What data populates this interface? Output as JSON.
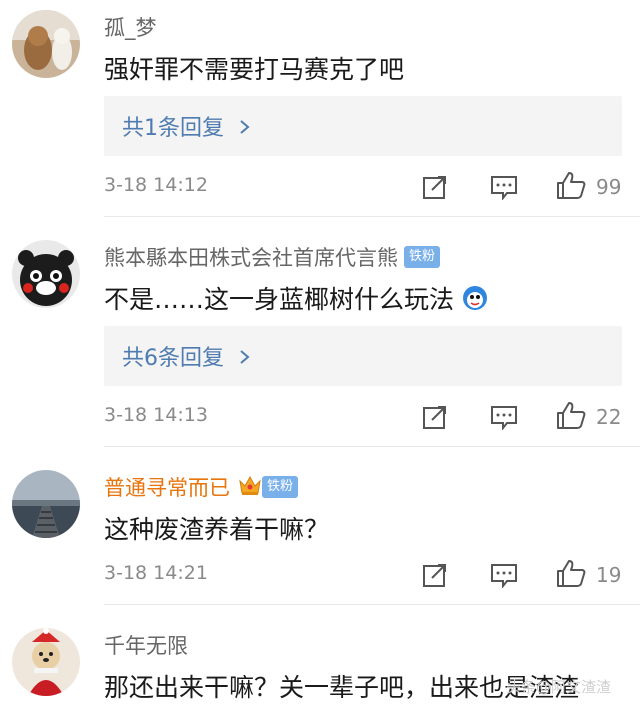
{
  "comments": [
    {
      "username": "孤_梦",
      "text": "强奸罪不需要打马赛克了吧",
      "replies": "共1条回复",
      "time": "3-18 14:12",
      "likes": "99",
      "badge": ""
    },
    {
      "username": "熊本縣本田株式会社首席代言熊",
      "text": "不是……这一身蓝椰树什么玩法",
      "replies": "共6条回复",
      "time": "3-18 14:13",
      "likes": "22",
      "badge": "铁粉"
    },
    {
      "username": "普通寻常而已",
      "text": "这种废渣养着干嘛？",
      "replies": "",
      "time": "3-18 14:21",
      "likes": "19",
      "badge": "铁粉"
    },
    {
      "username": "千年无限",
      "text": "那还出来干嘛？关一辈子吧，出来也是渣渣",
      "replies": "",
      "time": "",
      "likes": "",
      "badge": ""
    }
  ],
  "icons": {
    "share": "share-icon",
    "comment": "comment-icon",
    "like": "thumbs-up-icon",
    "chevron": "chevron-right-icon",
    "emoji": "blue-face-emoji-icon",
    "vip": "crown-icon"
  },
  "colors": {
    "reply_link": "#4f7cb0",
    "vip_name": "#e8750e",
    "badge": "#7ab0ea",
    "reply_bg": "#f4f4f4"
  },
  "watermark": "头条@阿文渣渣"
}
